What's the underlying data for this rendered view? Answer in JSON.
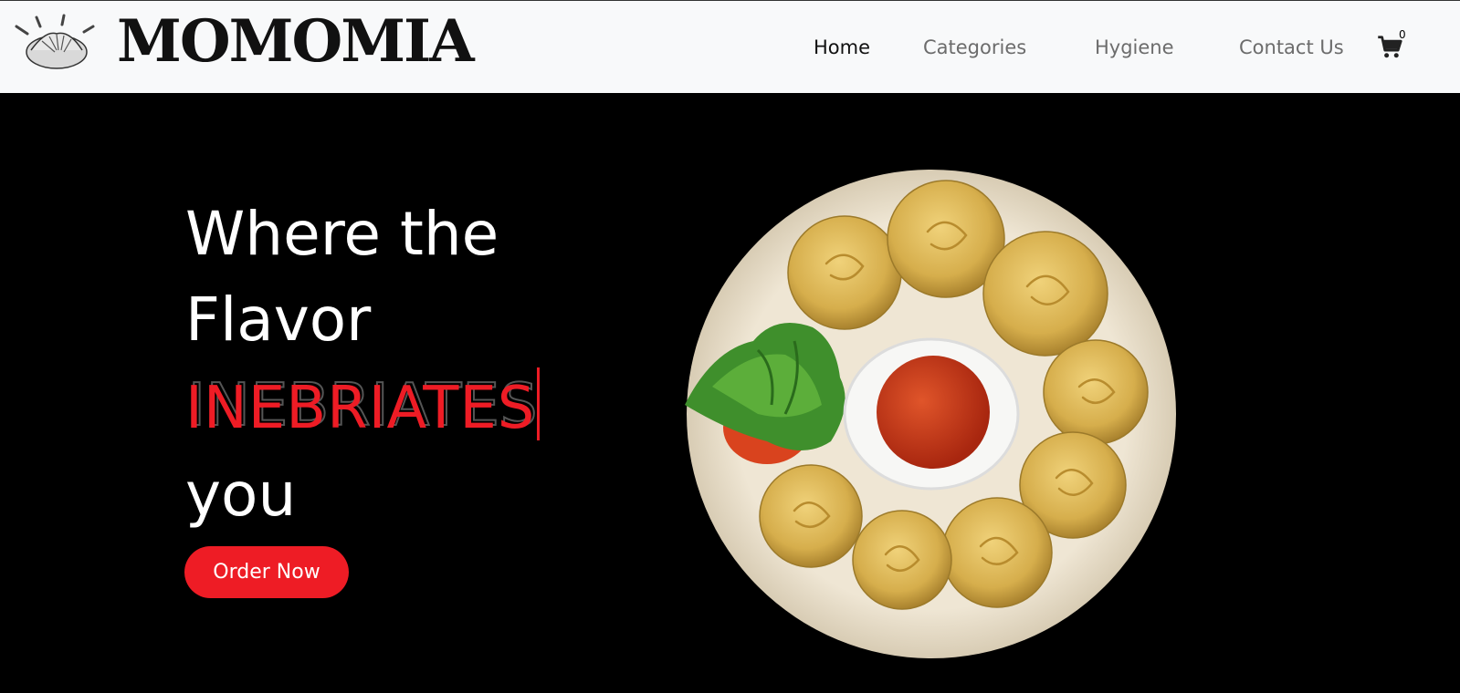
{
  "brand": {
    "name": "MOMOMIA",
    "logo_icon": "dumpling-logo-icon"
  },
  "nav": {
    "items": [
      {
        "label": "Home",
        "active": true
      },
      {
        "label": "Categories",
        "active": false
      },
      {
        "label": "Hygiene",
        "active": false
      },
      {
        "label": "Contact Us",
        "active": false
      }
    ],
    "cart_icon": "shopping-cart-icon",
    "cart_count": "0"
  },
  "hero": {
    "line1": "Where the",
    "line2": "Flavor",
    "accent": "INEBRIATES",
    "line4": "you",
    "cta_label": "Order Now",
    "image_icon": "momo-plate-image"
  },
  "colors": {
    "accent": "#ee1c25",
    "nav_bg": "#f8f9fa",
    "hero_bg": "#000000",
    "nav_text": "#6c6c6c"
  }
}
